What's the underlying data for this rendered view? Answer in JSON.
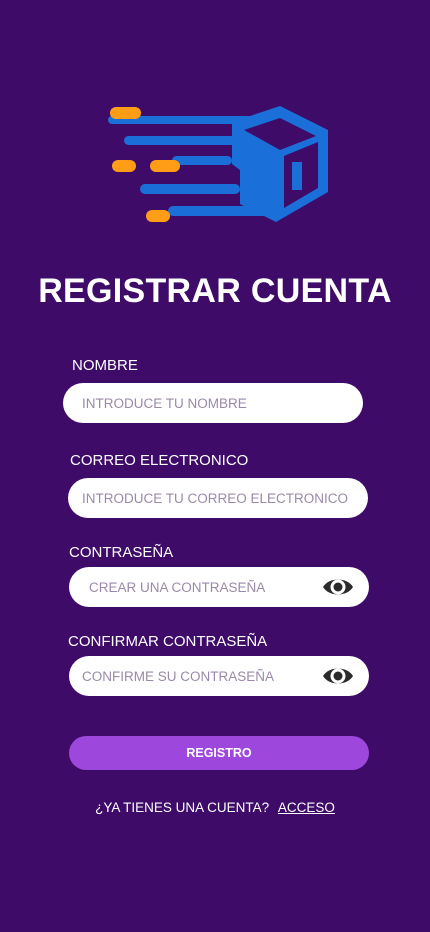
{
  "header": {
    "title": "REGISTRAR CUENTA",
    "logo_icon": "delivery-box-icon"
  },
  "form": {
    "name": {
      "label": "NOMBRE",
      "placeholder": "INTRODUCE TU NOMBRE"
    },
    "email": {
      "label": "CORREO ELECTRONICO",
      "placeholder": "INTRODUCE TU CORREO ELECTRONICO"
    },
    "password": {
      "label": "CONTRASEÑA",
      "placeholder": "CREAR UNA CONTRASEÑA",
      "toggle_icon": "eye-icon"
    },
    "confirm": {
      "label": "CONFIRMAR CONTRASEÑA",
      "placeholder": "CONFIRME SU CONTRASEÑA",
      "toggle_icon": "eye-icon"
    },
    "submit_label": "REGISTRO"
  },
  "footer": {
    "prompt": "¿YA TIENES UNA CUENTA?",
    "link": "ACCESO"
  },
  "colors": {
    "background": "#3e0b69",
    "button": "#9d47dc",
    "logo_blue": "#1a6fd8",
    "logo_orange": "#ff9e16"
  }
}
